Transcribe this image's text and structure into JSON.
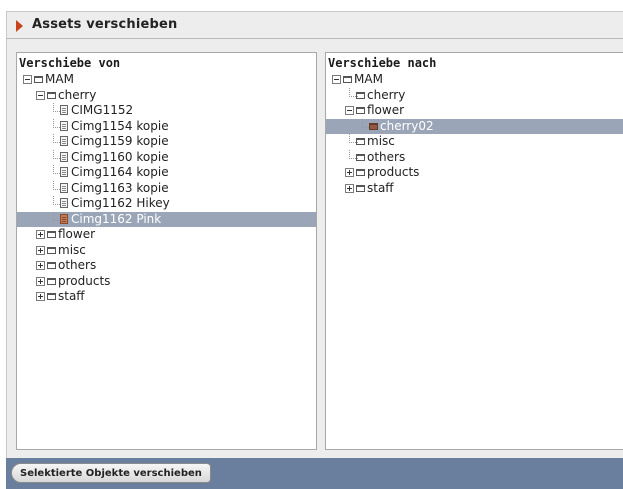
{
  "window": {
    "title": "Assets verschieben"
  },
  "source_pane": {
    "heading": "Verschiebe von",
    "nodes": [
      {
        "label": "MAM",
        "type": "folder",
        "level": 0,
        "toggle": "minus"
      },
      {
        "label": "cherry",
        "type": "folder",
        "level": 1,
        "toggle": "minus"
      },
      {
        "label": "CIMG1152",
        "type": "file",
        "level": 2
      },
      {
        "label": "Cimg1154 kopie",
        "type": "file",
        "level": 2
      },
      {
        "label": "Cimg1159 kopie",
        "type": "file",
        "level": 2
      },
      {
        "label": "Cimg1160 kopie",
        "type": "file",
        "level": 2
      },
      {
        "label": "Cimg1164 kopie",
        "type": "file",
        "level": 2
      },
      {
        "label": "Cimg1163 kopie",
        "type": "file",
        "level": 2
      },
      {
        "label": "Cimg1162 Hikey",
        "type": "file",
        "level": 2
      },
      {
        "label": "Cimg1162 Pink",
        "type": "file",
        "level": 2,
        "selected": true
      },
      {
        "label": "flower",
        "type": "folder",
        "level": 1,
        "toggle": "plus"
      },
      {
        "label": "misc",
        "type": "folder",
        "level": 1,
        "toggle": "plus"
      },
      {
        "label": "others",
        "type": "folder",
        "level": 1,
        "toggle": "plus"
      },
      {
        "label": "products",
        "type": "folder",
        "level": 1,
        "toggle": "plus"
      },
      {
        "label": "staff",
        "type": "folder",
        "level": 1,
        "toggle": "plus"
      }
    ]
  },
  "target_pane": {
    "heading": "Verschiebe nach",
    "nodes": [
      {
        "label": "MAM",
        "type": "folder",
        "level": 0,
        "toggle": "minus"
      },
      {
        "label": "cherry",
        "type": "folder",
        "level": 1
      },
      {
        "label": "flower",
        "type": "folder",
        "level": 1,
        "toggle": "minus"
      },
      {
        "label": "cherry02",
        "type": "folder",
        "level": 2,
        "selected": true
      },
      {
        "label": "misc",
        "type": "folder",
        "level": 1
      },
      {
        "label": "others",
        "type": "folder",
        "level": 1
      },
      {
        "label": "products",
        "type": "folder",
        "level": 1,
        "toggle": "plus"
      },
      {
        "label": "staff",
        "type": "folder",
        "level": 1,
        "toggle": "plus"
      }
    ]
  },
  "footer": {
    "move_button_label": "Selektierte Objekte verschieben"
  },
  "colors": {
    "selection": "#9aa6b8",
    "footer_bar": "#6a7f9e",
    "title_arrow": "#c8421c"
  }
}
